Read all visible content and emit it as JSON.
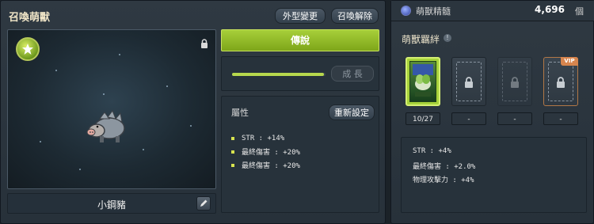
{
  "left": {
    "title": "召喚萌獸",
    "appearance_button": "外型變更",
    "release_button": "召喚解除",
    "pet_name": "小鋼豬",
    "grade_label": "傳說",
    "growth_button": "成 長",
    "growth_progress": 0.98,
    "attributes_title": "屬性",
    "reset_button": "重新設定",
    "attributes": [
      "STR : +14%",
      "最終傷害 : +20%",
      "最終傷害 : +20%"
    ]
  },
  "right": {
    "essence_label": "萌獸精髓",
    "essence_value": "4,696",
    "essence_unit": "個",
    "bond_title": "萌獸羈絆",
    "info_glyph": "!",
    "slots": [
      {
        "label": "10/27"
      },
      {
        "label": "-"
      },
      {
        "label": "-"
      },
      {
        "label": "-"
      }
    ],
    "vip_label": "VIP",
    "bond_stats": [
      "STR : +4%",
      "最終傷害 : +2.0%",
      "物理攻擊力 : +4%"
    ]
  },
  "colors": {
    "accent_green": "#9ac82f",
    "vip_orange": "#d7854e"
  },
  "icons": [
    "star-badge-icon",
    "lock-icon",
    "edit-pencil-icon",
    "essence-gem-icon",
    "info-icon"
  ]
}
